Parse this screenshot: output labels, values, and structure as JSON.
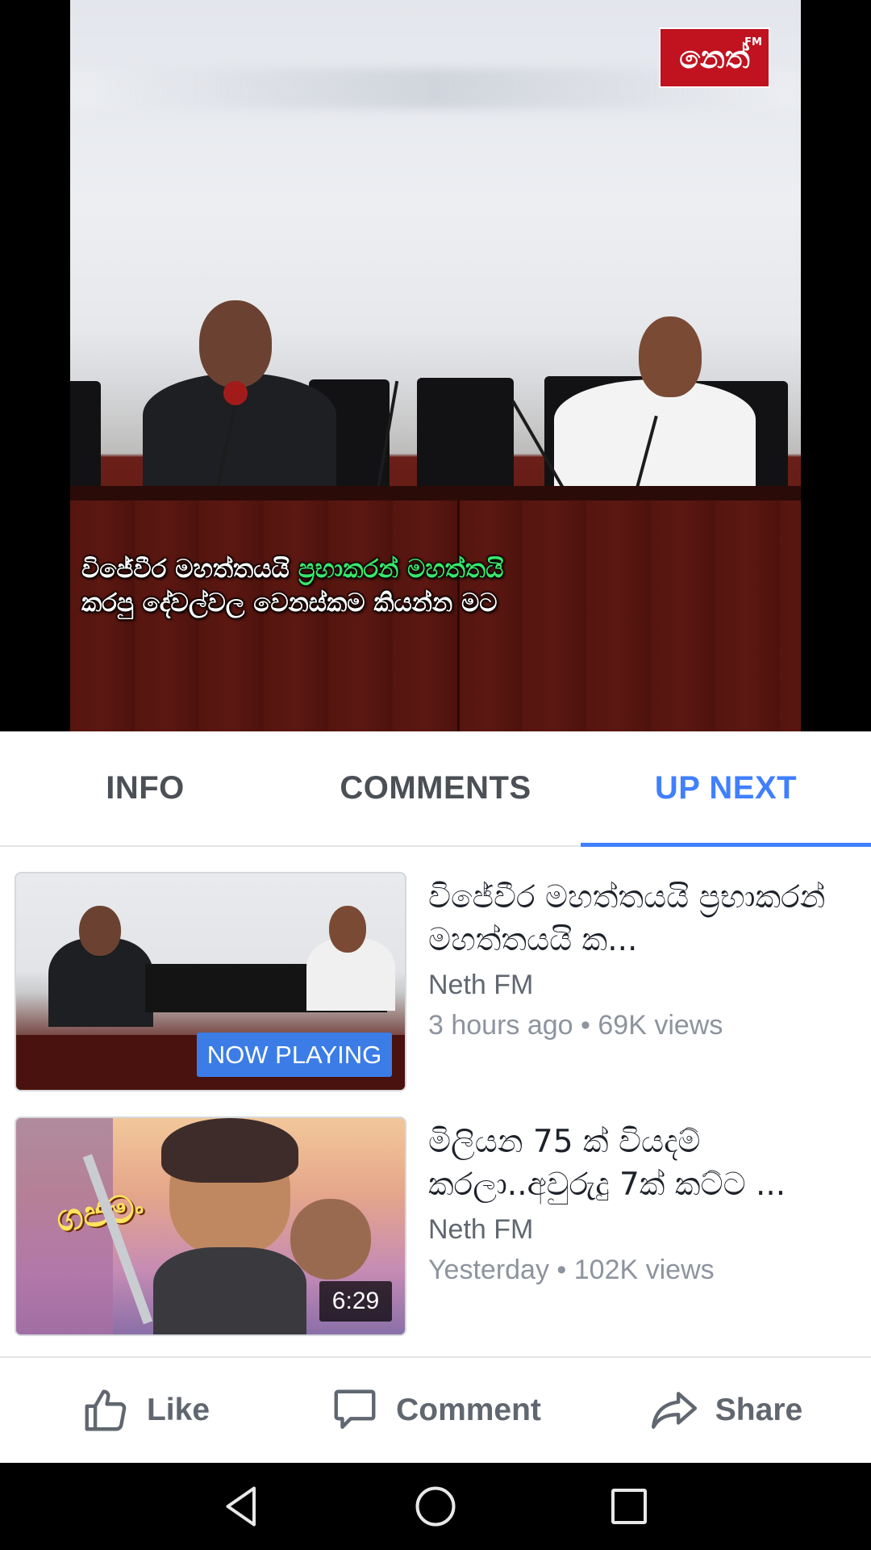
{
  "video": {
    "subtitle_line1_a": "විජේවීර මහත්තයයි",
    "subtitle_line1_b": "ප්‍රභාකරන් මහත්තයි",
    "subtitle_line2": "කරපු දේවල්වල වෙනස්කම කියන්න මට",
    "logo_text": "නෙත්",
    "logo_sup": "FM"
  },
  "tabs": [
    {
      "label": "INFO",
      "active": false
    },
    {
      "label": "COMMENTS",
      "active": false
    },
    {
      "label": "UP NEXT",
      "active": true
    }
  ],
  "up_next": [
    {
      "title": "විජේවීර මහත්තයයි ප්‍රභාකරන් මහත්තයයි ක...",
      "channel": "Neth FM",
      "stats": "3 hours ago • 69K views",
      "badge": "NOW PLAYING"
    },
    {
      "title": "මිලියන 75 ක් වියදම් කරලා..අවුරුදු 7ක් කට්ට ...",
      "channel": "Neth FM",
      "stats": "Yesterday • 102K views",
      "badge": "6:29"
    }
  ],
  "actions": {
    "like": "Like",
    "comment": "Comment",
    "share": "Share"
  },
  "colors": {
    "accent": "#4080ff",
    "now_playing_badge": "#3b7ce6",
    "subtitle_highlight": "#39e86a",
    "logo_red": "#c0121f"
  },
  "icons": [
    "like-icon",
    "comment-icon",
    "share-icon",
    "back-icon",
    "home-icon",
    "recents-icon"
  ]
}
